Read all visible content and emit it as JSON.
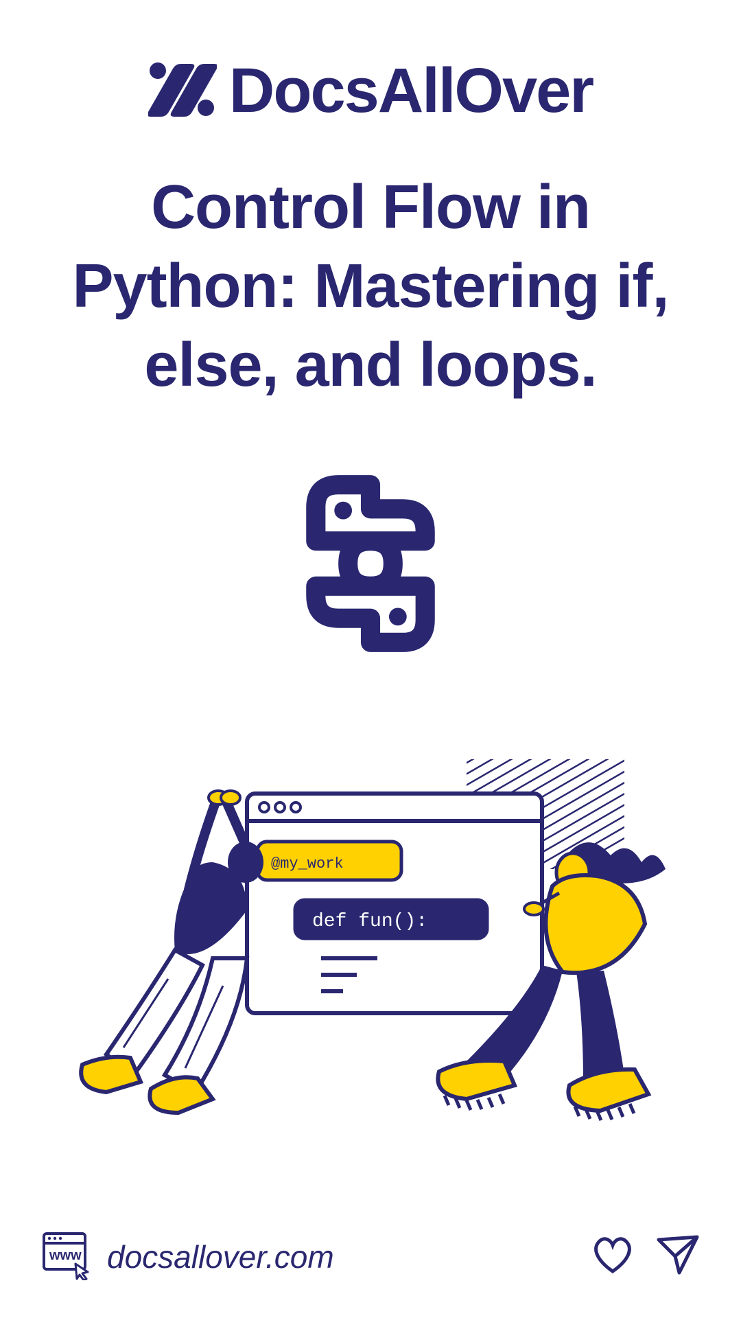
{
  "brand": {
    "name": "DocsAllOver"
  },
  "title": "Control Flow in Python: Mastering if, else, and loops.",
  "illustration": {
    "badge": "@my_work",
    "code": "def fun():"
  },
  "footer": {
    "domain": "docsallover.com",
    "www_label": "www"
  },
  "colors": {
    "primary": "#2a2770",
    "accent": "#ffd100"
  }
}
